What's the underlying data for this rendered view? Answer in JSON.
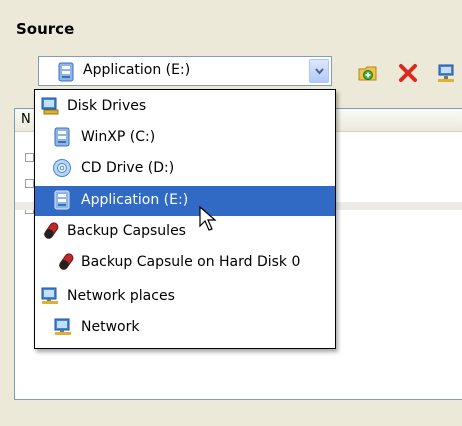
{
  "source": {
    "label": "Source",
    "combo": {
      "selected": "Application (E:)"
    },
    "toolbar": {
      "icons": [
        "add-folder-icon",
        "delete-icon",
        "network-icon"
      ]
    }
  },
  "list": {
    "header_text": "N"
  },
  "dropdown": {
    "items": [
      {
        "label": "Disk Drives",
        "icon": "disk-drives-icon"
      },
      {
        "label": "WinXP (C:)",
        "icon": "hard-drive-icon"
      },
      {
        "label": "CD Drive (D:)",
        "icon": "cd-drive-icon"
      },
      {
        "label": "Application (E:)",
        "icon": "hard-drive-icon",
        "selected": true
      },
      {
        "label": "Backup Capsules",
        "icon": "backup-capsule-icon"
      },
      {
        "label": "Backup Capsule on Hard Disk 0",
        "icon": "backup-capsule-icon"
      },
      {
        "label": "Network places",
        "icon": "network-places-icon"
      },
      {
        "label": "Network",
        "icon": "network-icon"
      }
    ]
  },
  "colors": {
    "selection": "#316ac5",
    "window_bg": "#ece9d8",
    "border": "#7f9db9"
  }
}
